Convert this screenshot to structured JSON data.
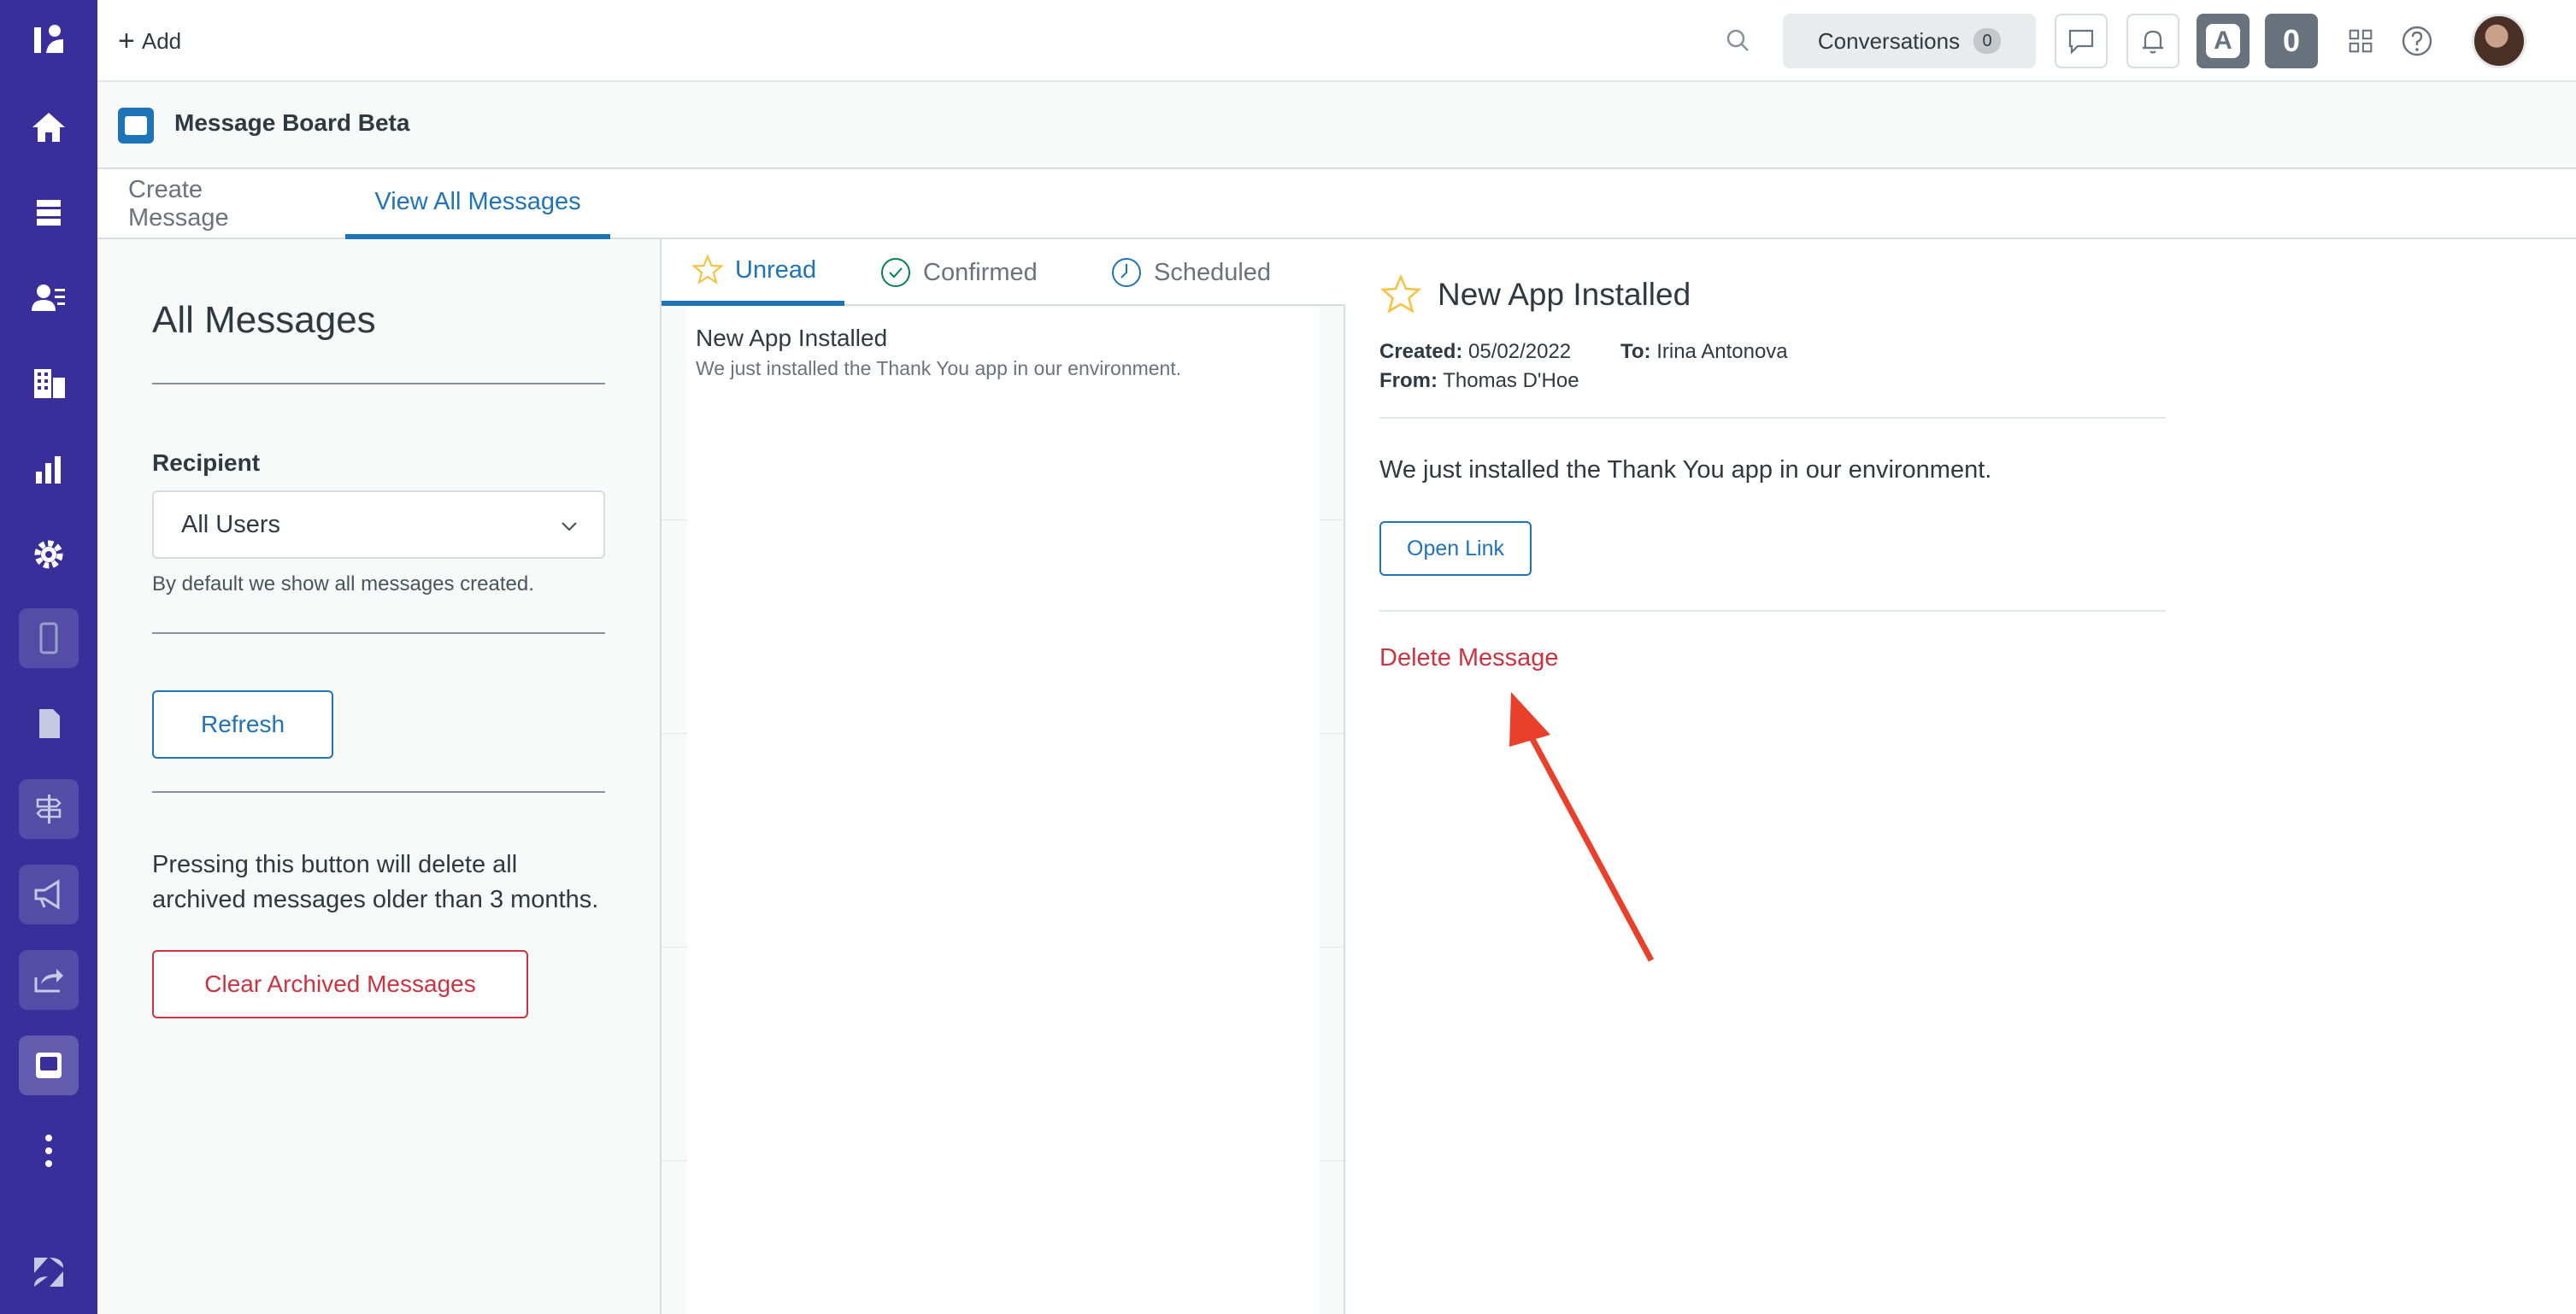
{
  "topbar": {
    "add_label": "Add",
    "conversations_label": "Conversations",
    "conversations_count": "0",
    "badge_a": "A",
    "badge_count": "0"
  },
  "app": {
    "title": "Message Board Beta"
  },
  "main_tabs": [
    {
      "label": "Create Message",
      "selected": false
    },
    {
      "label": "View All Messages",
      "selected": true
    }
  ],
  "left_panel": {
    "title": "All Messages",
    "recipient_label": "Recipient",
    "recipient_value": "All Users",
    "recipient_hint": "By default we show all messages created.",
    "refresh_label": "Refresh",
    "warning_text": "Pressing this button will delete all archived messages older than 3 months.",
    "clear_label": "Clear Archived Messages"
  },
  "message_tabs": [
    {
      "label": "Unread",
      "icon": "star-icon",
      "selected": true
    },
    {
      "label": "Confirmed",
      "icon": "check-circle-icon",
      "selected": false
    },
    {
      "label": "Scheduled",
      "icon": "clock-icon",
      "selected": false
    }
  ],
  "messages": [
    {
      "title": "New App Installed",
      "preview": "We just installed the Thank You app in our environment."
    }
  ],
  "detail": {
    "title": "New App Installed",
    "created_label": "Created:",
    "created_value": "05/02/2022",
    "to_label": "To:",
    "to_value": "Irina Antonova",
    "from_label": "From:",
    "from_value": "Thomas D'Hoe",
    "body": "We just installed the Thank You app in our environment.",
    "open_link_label": "Open Link",
    "delete_label": "Delete Message"
  },
  "colors": {
    "sidebar": "#3a2f9a",
    "accent": "#1f73b7",
    "danger": "#cc3340",
    "annotation_arrow": "#e8402b",
    "star": "#f5c242"
  }
}
